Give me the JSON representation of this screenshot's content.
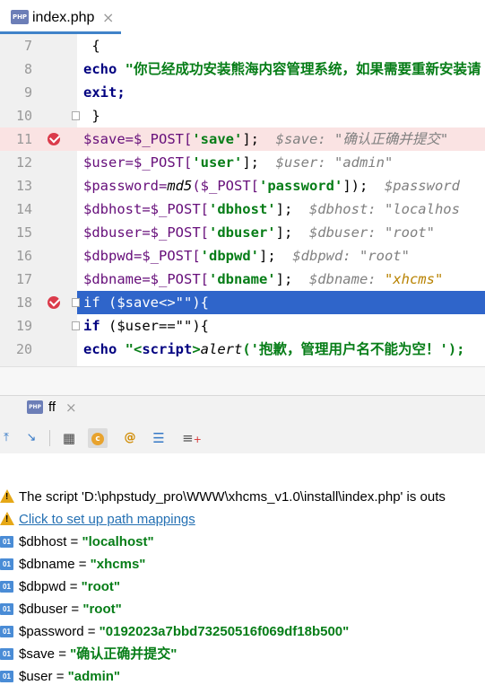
{
  "editor_tab": {
    "icon": "PHP",
    "label": "index.php",
    "close": "×"
  },
  "code_lines": [
    {
      "num": "7"
    },
    {
      "num": "8"
    },
    {
      "num": "9"
    },
    {
      "num": "10"
    },
    {
      "num": "11"
    },
    {
      "num": "12"
    },
    {
      "num": "13"
    },
    {
      "num": "14"
    },
    {
      "num": "15"
    },
    {
      "num": "16"
    },
    {
      "num": "17"
    },
    {
      "num": "18"
    },
    {
      "num": "19"
    },
    {
      "num": "20"
    }
  ],
  "code": {
    "l7": " {",
    "l8_kw": "echo",
    "l8_str": " \"你已经成功安装熊海内容管理系统，如果需要重新安装请",
    "l9": "exit;",
    "l10": " }",
    "l11_a": "$save=$_POST[",
    "l11_key": "'save'",
    "l11_b": "];",
    "l11_hint": "  $save: \"确认正确并提交\"",
    "l12_a": "$user=$_POST[",
    "l12_key": "'user'",
    "l12_b": "];",
    "l12_hint": "  $user: \"admin\"",
    "l13_a": "$password=",
    "l13_fn": "md5",
    "l13_b": "($_POST[",
    "l13_key": "'password'",
    "l13_c": "]);",
    "l13_hint": "  $password",
    "l14_a": "$dbhost=$_POST[",
    "l14_key": "'dbhost'",
    "l14_b": "];",
    "l14_hint": "  $dbhost: \"localhos",
    "l15_a": "$dbuser=$_POST[",
    "l15_key": "'dbuser'",
    "l15_b": "];",
    "l15_hint": "  $dbuser: \"root\"",
    "l16_a": "$dbpwd=$_POST[",
    "l16_key": "'dbpwd'",
    "l16_b": "];",
    "l16_hint": "  $dbpwd: \"root\"",
    "l17_a": "$dbname=$_POST[",
    "l17_key": "'dbname'",
    "l17_b": "];",
    "l17_hint_a": "  $dbname: ",
    "l17_hint_b": "\"xhcms\"",
    "l18": "if ($save<>\"\"){",
    "l19_kw": "if",
    "l19_rest": " ($user==\"\"){",
    "l20_kw": "echo",
    "l20_a": " \"<",
    "l20_tag": "script",
    "l20_b": ">",
    "l20_fn": "alert",
    "l20_c": "('抱歉，管理用户名不能为空！');"
  },
  "debug_tab": {
    "icon": "PHP",
    "label": "ff",
    "close": "×"
  },
  "messages": [
    {
      "text": "The script 'D:\\phpstudy_pro\\WWW\\xhcms_v1.0\\install\\index.php' is outs"
    },
    {
      "text": "Click to set up path mappings"
    }
  ],
  "variables": [
    {
      "name": "$dbhost",
      "eq": " = ",
      "value": "\"localhost\""
    },
    {
      "name": "$dbname",
      "eq": " = ",
      "value": "\"xhcms\""
    },
    {
      "name": "$dbpwd",
      "eq": " = ",
      "value": "\"root\""
    },
    {
      "name": "$dbuser",
      "eq": " = ",
      "value": "\"root\""
    },
    {
      "name": "$password",
      "eq": " = ",
      "value": "\"0192023a7bbd73250516f069df18b500\""
    },
    {
      "name": "$save",
      "eq": " = ",
      "value": "\"确认正确并提交\""
    },
    {
      "name": "$user",
      "eq": " = ",
      "value": "\"admin\""
    }
  ],
  "var_icon": "01",
  "colors": {
    "selection": "#2f65ca",
    "breakpoint_line": "#fae3e3",
    "string": "#067d17",
    "keyword": "#000080"
  }
}
